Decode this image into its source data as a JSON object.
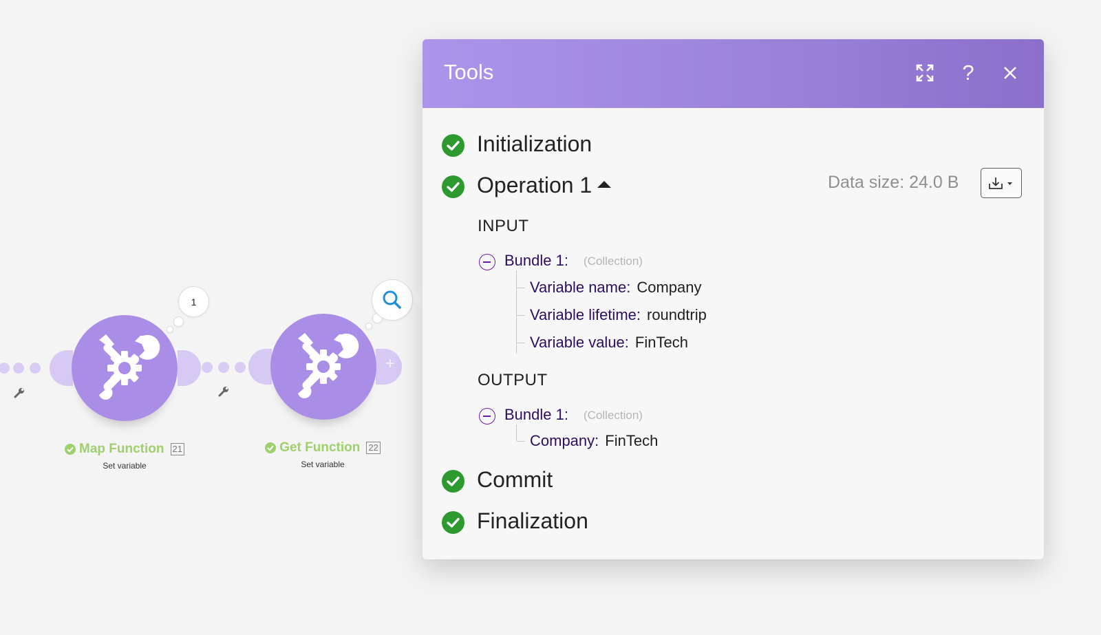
{
  "canvas": {
    "modules": [
      {
        "name": "Map Function",
        "id": "21",
        "subtitle": "Set variable"
      },
      {
        "name": "Get Function",
        "id": "22",
        "subtitle": "Set variable"
      }
    ],
    "operations_bubble": "1",
    "icons": {
      "module": "tools-icon",
      "filter": "wrench-icon",
      "inspect": "search-icon",
      "add": "plus-icon"
    },
    "colors": {
      "module": "#a98de6",
      "success_label": "#9fd06d"
    }
  },
  "panel": {
    "title": "Tools",
    "header_buttons": [
      "expand-icon",
      "help-icon",
      "close-icon"
    ],
    "stages": {
      "initialization": "Initialization",
      "operation": "Operation 1",
      "commit": "Commit",
      "finalization": "Finalization"
    },
    "data_size": "Data size: 24.0 B",
    "input": {
      "heading": "INPUT",
      "bundle_label": "Bundle 1:",
      "bundle_type": "(Collection)",
      "rows": [
        {
          "key": "Variable name:",
          "value": "Company"
        },
        {
          "key": "Variable lifetime:",
          "value": "roundtrip"
        },
        {
          "key": "Variable value:",
          "value": "FinTech"
        }
      ]
    },
    "output": {
      "heading": "OUTPUT",
      "bundle_label": "Bundle 1:",
      "bundle_type": "(Collection)",
      "rows": [
        {
          "key": "Company:",
          "value": "FinTech"
        }
      ]
    },
    "colors": {
      "header_start": "#ab95ea",
      "header_end": "#8b6fcb",
      "success": "#2c9a2e",
      "key_text": "#2b0e60"
    }
  }
}
